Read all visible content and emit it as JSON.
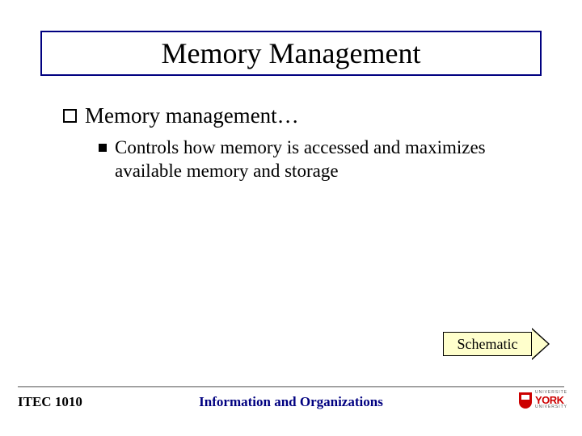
{
  "title": "Memory Management",
  "bullet": {
    "text": "Memory management…",
    "sub": "Controls how memory is accessed and maximizes available memory and storage"
  },
  "arrow_label": "Schematic",
  "footer": {
    "left": "ITEC 1010",
    "center": "Information and Organizations"
  },
  "logo": {
    "top": "UNIVERSITE",
    "main": "YORK",
    "sub": "UNIVERSITY"
  }
}
